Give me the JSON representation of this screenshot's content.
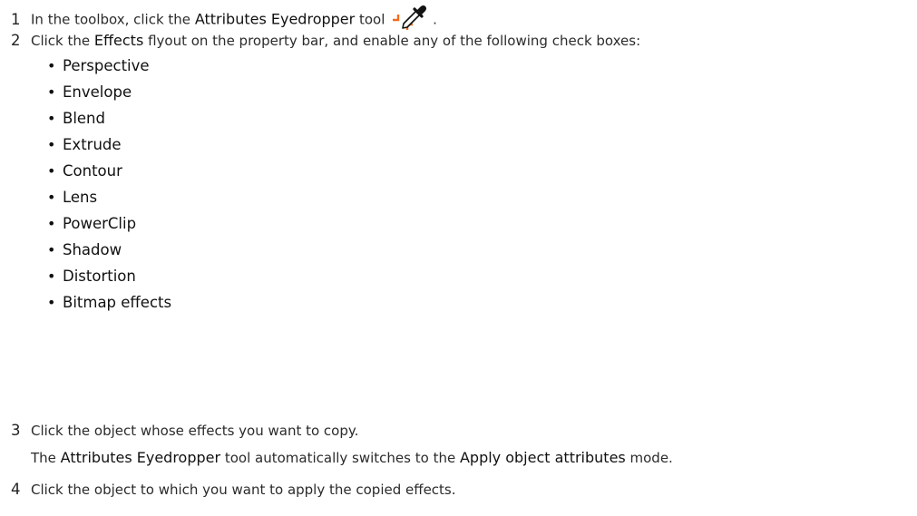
{
  "steps": [
    {
      "num": "1",
      "text1": "In the toolbox, click the ",
      "ui1": "Attributes Eyedropper",
      "text2": " tool ",
      "text3": "."
    },
    {
      "num": "2",
      "text1": "Click the ",
      "ui1": "Effects",
      "text2": " flyout on the property bar, and enable any of the following check boxes:"
    },
    {
      "num": "3",
      "text1": "Click the object whose effects you want to copy.",
      "result_text1": "The ",
      "result_ui1": "Attributes Eyedropper",
      "result_text2": " tool automatically switches to the ",
      "result_ui2": "Apply object attributes",
      "result_text3": " mode."
    },
    {
      "num": "4",
      "text1": "Click the object to which you want to apply the copied effects."
    }
  ],
  "bullet_char": "•",
  "effects": [
    "Perspective",
    "Envelope",
    "Blend",
    "Extrude",
    "Contour",
    "Lens",
    "PowerClip",
    "Shadow",
    "Distortion",
    "Bitmap effects"
  ],
  "icons": {
    "tool_icon": "attributes-eyedropper-icon",
    "accent_color": "#f26b1d"
  }
}
